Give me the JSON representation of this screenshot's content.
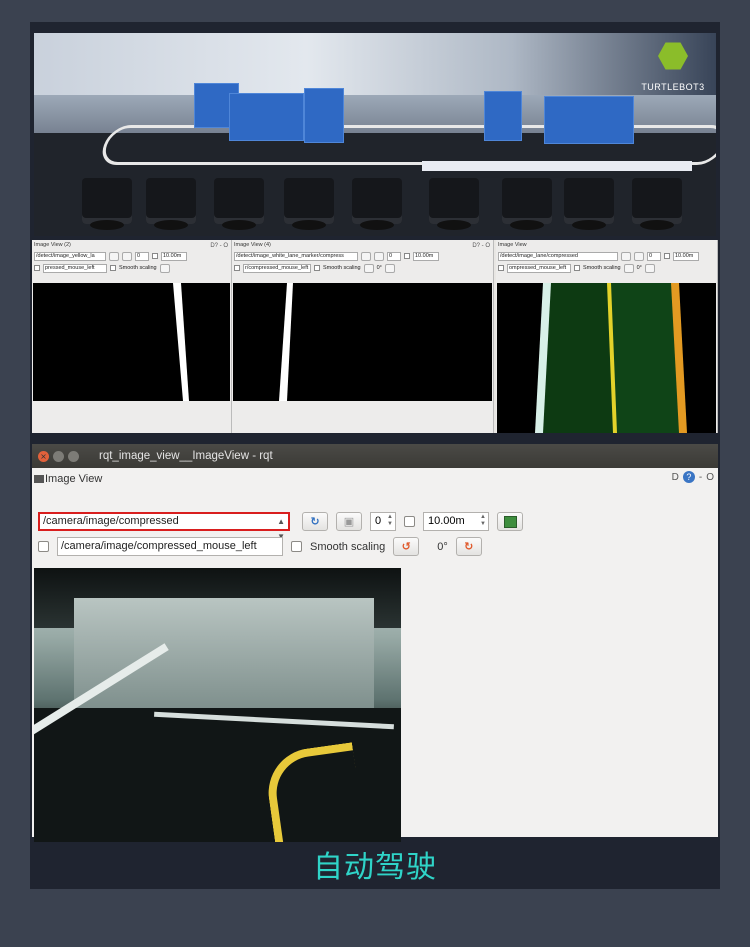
{
  "hero": {
    "logo_text": "TURTLEBOT3"
  },
  "panels": [
    {
      "title": "Image View (2)",
      "topic": "/detect/image_yellow_la",
      "mouse_topic": "pressed_mouse_left",
      "spin": "0",
      "zoom": "10.00m",
      "rotation": "0°",
      "smooth_label": "Smooth scaling"
    },
    {
      "title": "Image View (4)",
      "topic": "/detect/image_white_lane_marker/compress",
      "mouse_topic": "r/compressed_mouse_left",
      "spin": "0",
      "zoom": "10.00m",
      "rotation": "0°",
      "smooth_label": "Smooth scaling"
    },
    {
      "title": "Image View",
      "topic": "/detect/image_lane/compressed",
      "mouse_topic": "ompressed_mouse_left",
      "spin": "0",
      "zoom": "10.00m",
      "rotation": "0°",
      "smooth_label": "Smooth scaling"
    }
  ],
  "window": {
    "title": "rqt_image_view__ImageView - rqt",
    "plugin_title": "Image View",
    "right_controls": "D? - O",
    "topic": "/camera/image/compressed",
    "spin_value": "0",
    "zoom_value": "10.00m",
    "mouse_topic": "/camera/image/compressed_mouse_left",
    "smooth_label": "Smooth scaling",
    "rotation": "0°"
  },
  "caption": "自动驾驶",
  "colors": {
    "highlight": "#d91e1e",
    "caption": "#2fd4c8",
    "lane_green": "#0d3a12",
    "lane_yellow": "#e3d22a"
  }
}
